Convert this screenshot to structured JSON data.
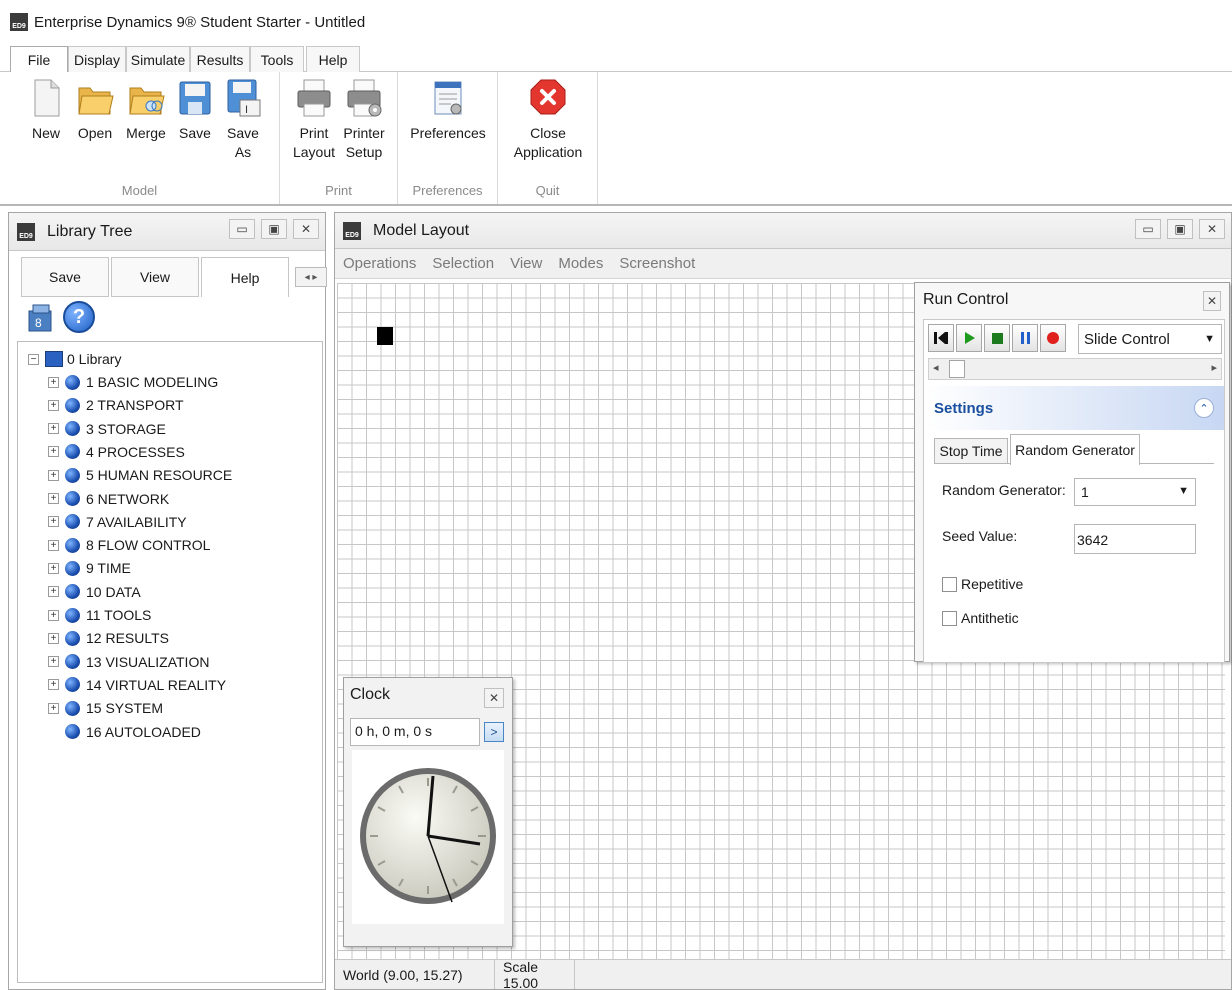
{
  "app": {
    "icon_text": "ED9",
    "title": "Enterprise Dynamics 9® Student Starter - Untitled"
  },
  "ribbon": {
    "tabs": [
      "File",
      "Display",
      "Simulate",
      "Results",
      "Tools",
      "Help"
    ],
    "active_tab": "File",
    "groups": {
      "model": {
        "label": "Model",
        "buttons": [
          {
            "label": "New",
            "icon": "new-file-icon"
          },
          {
            "label": "Open",
            "icon": "open-folder-icon"
          },
          {
            "label": "Merge",
            "icon": "merge-folder-icon"
          },
          {
            "label": "Save",
            "icon": "save-floppy-icon"
          },
          {
            "label_line1": "Save",
            "label_line2": "As",
            "icon": "save-as-icon"
          }
        ]
      },
      "print": {
        "label": "Print",
        "buttons": [
          {
            "label_line1": "Print",
            "label_line2": "Layout",
            "icon": "printer-icon"
          },
          {
            "label_line1": "Printer",
            "label_line2": "Setup",
            "icon": "printer-setup-icon"
          }
        ]
      },
      "preferences": {
        "label": "Preferences",
        "buttons": [
          {
            "label": "Preferences",
            "icon": "preferences-icon"
          }
        ]
      },
      "quit": {
        "label": "Quit",
        "buttons": [
          {
            "label_line1": "Close",
            "label_line2": "Application",
            "icon": "close-application-icon"
          }
        ]
      }
    }
  },
  "library": {
    "title": "Library Tree",
    "tabs": [
      "Save",
      "View",
      "Help"
    ],
    "active_tab": "Help",
    "root": "0 Library",
    "items": [
      "1 BASIC MODELING",
      "2 TRANSPORT",
      "3 STORAGE",
      "4 PROCESSES",
      "5 HUMAN RESOURCE",
      "6 NETWORK",
      "7 AVAILABILITY",
      "8 FLOW CONTROL",
      "9 TIME",
      "10 DATA",
      "11 TOOLS",
      "12 RESULTS",
      "13 VISUALIZATION",
      "14 VIRTUAL REALITY",
      "15 SYSTEM",
      "16 AUTOLOADED"
    ]
  },
  "model_layout": {
    "title": "Model Layout",
    "menu": [
      "Operations",
      "Selection",
      "View",
      "Modes",
      "Screenshot"
    ],
    "status": {
      "world": "World (9.00, 15.27)",
      "scale": "Scale 15.00"
    }
  },
  "clock": {
    "title": "Clock",
    "time_text": "0 h, 0 m, 0 s",
    "expand_symbol": ">"
  },
  "run_control": {
    "title": "Run Control",
    "mode_select": "Slide Control",
    "settings_label": "Settings",
    "tabs": [
      "Stop Time",
      "Random Generator"
    ],
    "active_tab": "Random Generator",
    "random_generator_label": "Random Generator:",
    "random_generator_value": "1",
    "seed_label": "Seed Value:",
    "seed_value": "3642",
    "repetitive_label": "Repetitive",
    "repetitive_checked": false,
    "antithetic_label": "Antithetic",
    "antithetic_checked": false
  },
  "colors": {
    "accent_blue": "#2c6ad6",
    "close_red": "#e2362e",
    "play_green": "#1e9a1e",
    "record_red": "#e0201c",
    "pause_blue": "#2060c8"
  }
}
